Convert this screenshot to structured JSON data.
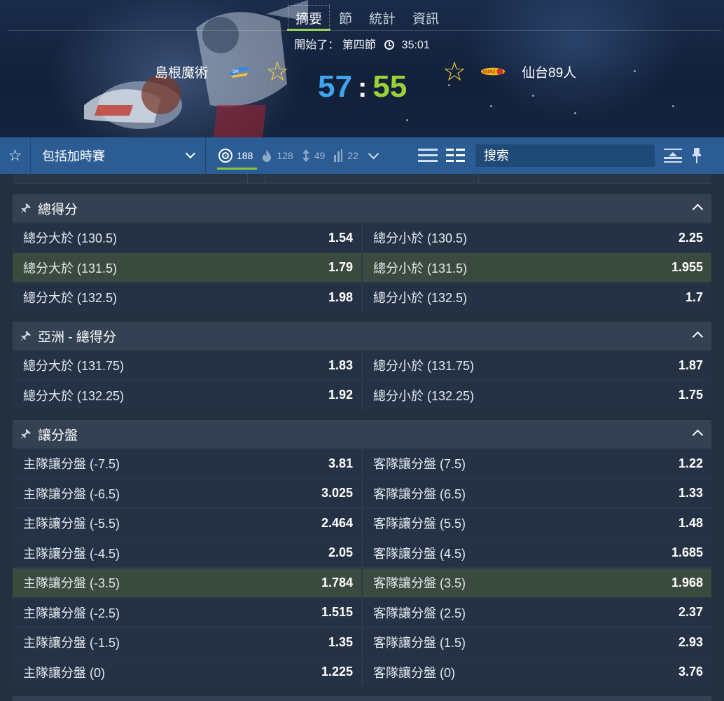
{
  "header": {
    "tabs": [
      {
        "label": "摘要",
        "active": true
      },
      {
        "label": "節"
      },
      {
        "label": "統計"
      },
      {
        "label": "資訊"
      }
    ],
    "status_prefix": "開始了：",
    "period": "第四節",
    "clock": "35:01",
    "home_team": "島根魔術",
    "away_team": "仙台89人",
    "home_score": "57",
    "away_score": "55",
    "score_separator": ":",
    "colors": {
      "home_score": "#3ea6f0",
      "away_score": "#9bd23a",
      "star": "#f5d33a",
      "active_underline": "#8cc63e"
    }
  },
  "toolbar": {
    "favorite_icon": "star-outline-icon",
    "select_value": "包括加時賽",
    "filters": [
      {
        "icon": "target-icon",
        "count": "188",
        "active": true
      },
      {
        "icon": "fire-icon",
        "count": "128"
      },
      {
        "icon": "updown-arrows-icon",
        "count": "49"
      },
      {
        "icon": "bars-icon",
        "count": "22"
      }
    ],
    "search_placeholder": "搜索"
  },
  "markets": [
    {
      "title": "總得分",
      "rows": [
        [
          {
            "label": "總分大於 (130.5)",
            "odds": "1.54"
          },
          {
            "label": "總分小於 (130.5)",
            "odds": "2.25"
          }
        ],
        [
          {
            "label": "總分大於 (131.5)",
            "odds": "1.79",
            "highlight": true
          },
          {
            "label": "總分小於 (131.5)",
            "odds": "1.955",
            "highlight": true
          }
        ],
        [
          {
            "label": "總分大於 (132.5)",
            "odds": "1.98"
          },
          {
            "label": "總分小於 (132.5)",
            "odds": "1.7"
          }
        ]
      ]
    },
    {
      "title": "亞洲 - 總得分",
      "rows": [
        [
          {
            "label": "總分大於 (131.75)",
            "odds": "1.83"
          },
          {
            "label": "總分小於 (131.75)",
            "odds": "1.87"
          }
        ],
        [
          {
            "label": "總分大於 (132.25)",
            "odds": "1.92"
          },
          {
            "label": "總分小於 (132.25)",
            "odds": "1.75"
          }
        ]
      ]
    },
    {
      "title": "讓分盤",
      "rows": [
        [
          {
            "label": "主隊讓分盤 (-7.5)",
            "odds": "3.81"
          },
          {
            "label": "客隊讓分盤 (7.5)",
            "odds": "1.22"
          }
        ],
        [
          {
            "label": "主隊讓分盤 (-6.5)",
            "odds": "3.025"
          },
          {
            "label": "客隊讓分盤 (6.5)",
            "odds": "1.33"
          }
        ],
        [
          {
            "label": "主隊讓分盤 (-5.5)",
            "odds": "2.464"
          },
          {
            "label": "客隊讓分盤 (5.5)",
            "odds": "1.48"
          }
        ],
        [
          {
            "label": "主隊讓分盤 (-4.5)",
            "odds": "2.05"
          },
          {
            "label": "客隊讓分盤 (4.5)",
            "odds": "1.685"
          }
        ],
        [
          {
            "label": "主隊讓分盤 (-3.5)",
            "odds": "1.784",
            "highlight": true
          },
          {
            "label": "客隊讓分盤 (3.5)",
            "odds": "1.968",
            "highlight": true
          }
        ],
        [
          {
            "label": "主隊讓分盤 (-2.5)",
            "odds": "1.515"
          },
          {
            "label": "客隊讓分盤 (2.5)",
            "odds": "2.37"
          }
        ],
        [
          {
            "label": "主隊讓分盤 (-1.5)",
            "odds": "1.35"
          },
          {
            "label": "客隊讓分盤 (1.5)",
            "odds": "2.93"
          }
        ],
        [
          {
            "label": "主隊讓分盤 (0)",
            "odds": "1.225"
          },
          {
            "label": "客隊讓分盤 (0)",
            "odds": "3.76"
          }
        ]
      ]
    }
  ]
}
